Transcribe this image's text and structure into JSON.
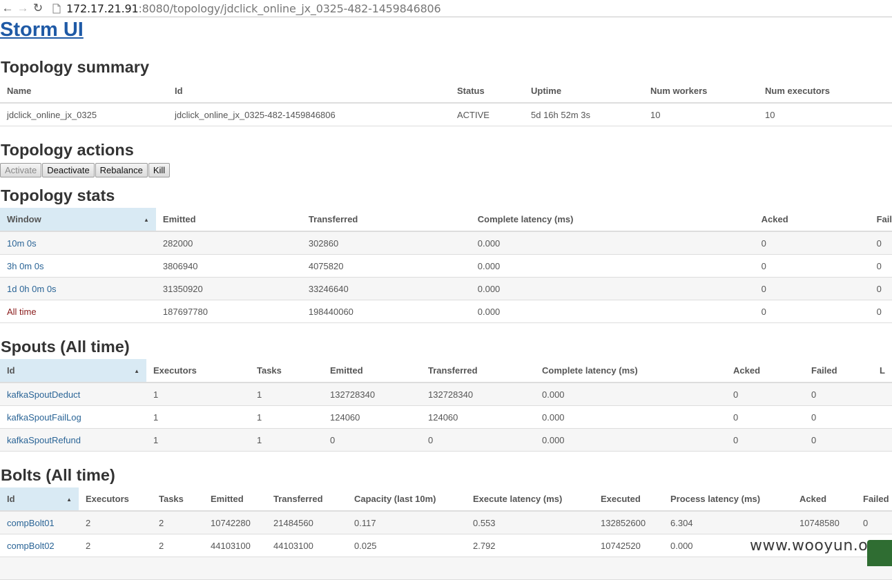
{
  "browser": {
    "url_host": "172.17.21.91",
    "url_rest": ":8080/topology/jdclick_online_jx_0325-482-1459846806"
  },
  "app_title": "Storm UI",
  "topology_summary": {
    "heading": "Topology summary",
    "headers": [
      "Name",
      "Id",
      "Status",
      "Uptime",
      "Num workers",
      "Num executors"
    ],
    "row": [
      "jdclick_online_jx_0325",
      "jdclick_online_jx_0325-482-1459846806",
      "ACTIVE",
      "5d 16h 52m 3s",
      "10",
      "10"
    ]
  },
  "topology_actions": {
    "heading": "Topology actions",
    "buttons": [
      "Activate",
      "Deactivate",
      "Rebalance",
      "Kill"
    ]
  },
  "topology_stats": {
    "heading": "Topology stats",
    "headers": [
      "Window",
      "Emitted",
      "Transferred",
      "Complete latency (ms)",
      "Acked",
      "Fail"
    ],
    "rows": [
      [
        "10m 0s",
        "282000",
        "302860",
        "0.000",
        "0",
        "0"
      ],
      [
        "3h 0m 0s",
        "3806940",
        "4075820",
        "0.000",
        "0",
        "0"
      ],
      [
        "1d 0h 0m 0s",
        "31350920",
        "33246640",
        "0.000",
        "0",
        "0"
      ],
      [
        "All time",
        "187697780",
        "198440060",
        "0.000",
        "0",
        "0"
      ]
    ]
  },
  "spouts": {
    "heading": "Spouts (All time)",
    "headers": [
      "Id",
      "Executors",
      "Tasks",
      "Emitted",
      "Transferred",
      "Complete latency (ms)",
      "Acked",
      "Failed",
      "L"
    ],
    "rows": [
      [
        "kafkaSpoutDeduct",
        "1",
        "1",
        "132728340",
        "132728340",
        "0.000",
        "0",
        "0"
      ],
      [
        "kafkaSpoutFailLog",
        "1",
        "1",
        "124060",
        "124060",
        "0.000",
        "0",
        "0"
      ],
      [
        "kafkaSpoutRefund",
        "1",
        "1",
        "0",
        "0",
        "0.000",
        "0",
        "0"
      ]
    ]
  },
  "bolts": {
    "heading": "Bolts (All time)",
    "headers": [
      "Id",
      "Executors",
      "Tasks",
      "Emitted",
      "Transferred",
      "Capacity (last 10m)",
      "Execute latency (ms)",
      "Executed",
      "Process latency (ms)",
      "Acked",
      "Failed"
    ],
    "rows": [
      [
        "compBolt01",
        "2",
        "2",
        "10742280",
        "21484560",
        "0.117",
        "0.553",
        "132852600",
        "6.304",
        "10748580",
        "0"
      ],
      [
        "compBolt02",
        "2",
        "2",
        "44103100",
        "44103100",
        "0.025",
        "2.792",
        "10742520",
        "0.000",
        "",
        ""
      ]
    ]
  },
  "watermark": "www.wooyun.org"
}
